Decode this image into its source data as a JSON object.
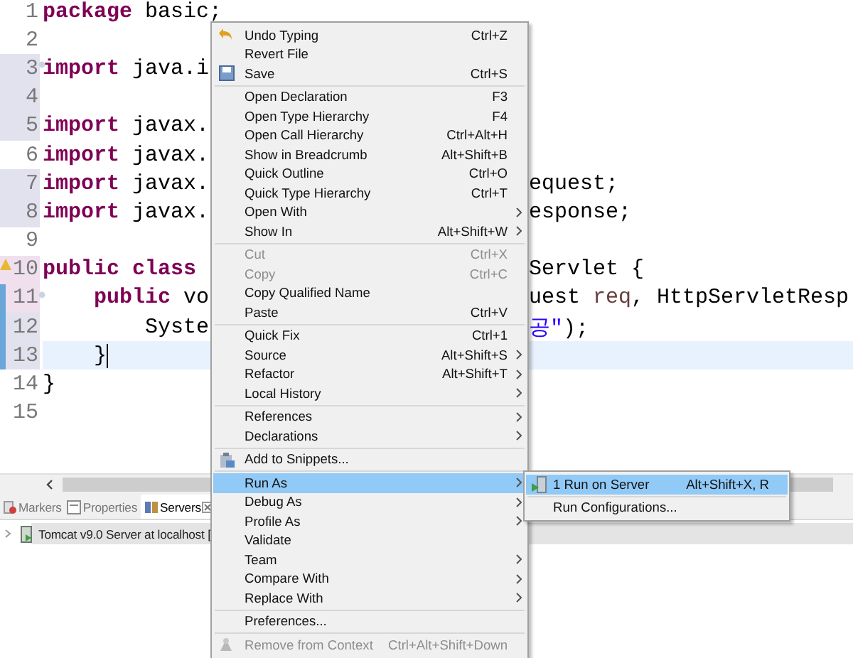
{
  "editor": {
    "lines": [
      {
        "number": "1",
        "changed": false,
        "added": false,
        "current": false,
        "left": [
          {
            "text": "package",
            "kind": "keyword"
          },
          {
            "text": " basic;",
            "kind": "plain"
          }
        ]
      },
      {
        "number": "2",
        "changed": false,
        "added": false,
        "current": false
      },
      {
        "number": "3",
        "changed": true,
        "added": false,
        "fold": true,
        "current": false,
        "left": [
          {
            "text": "import",
            "kind": "keyword"
          },
          {
            "text": " java.i",
            "kind": "plain"
          }
        ]
      },
      {
        "number": "4",
        "changed": true,
        "added": false,
        "current": false
      },
      {
        "number": "5",
        "changed": true,
        "added": false,
        "current": false,
        "left": [
          {
            "text": "import",
            "kind": "keyword"
          },
          {
            "text": " javax.",
            "kind": "plain"
          }
        ]
      },
      {
        "number": "6",
        "changed": false,
        "added": false,
        "current": false,
        "left": [
          {
            "text": "import",
            "kind": "keyword"
          },
          {
            "text": " javax.",
            "kind": "plain"
          }
        ]
      },
      {
        "number": "7",
        "changed": true,
        "added": false,
        "current": false,
        "left": [
          {
            "text": "import",
            "kind": "keyword"
          },
          {
            "text": " javax.",
            "kind": "plain"
          }
        ],
        "right": [
          {
            "text": "equest;",
            "kind": "plain"
          }
        ]
      },
      {
        "number": "8",
        "changed": true,
        "added": false,
        "current": false,
        "left": [
          {
            "text": "import",
            "kind": "keyword"
          },
          {
            "text": " javax.",
            "kind": "plain"
          }
        ],
        "right": [
          {
            "text": "esponse;",
            "kind": "plain"
          }
        ]
      },
      {
        "number": "9",
        "changed": false,
        "added": false,
        "current": false
      },
      {
        "number": "10",
        "changed": false,
        "added": true,
        "warning": true,
        "current": false,
        "left": [
          {
            "text": "public",
            "kind": "keyword"
          },
          {
            "text": " class",
            "kind": "keyword"
          }
        ],
        "right": [
          {
            "text": "Servlet {",
            "kind": "plain"
          }
        ]
      },
      {
        "number": "11",
        "changed": false,
        "added": true,
        "fold": true,
        "bar": true,
        "current": false,
        "left": [
          {
            "text": "    public",
            "kind": "keyword"
          },
          {
            "text": " vo",
            "kind": "plain"
          }
        ],
        "right": [
          {
            "text": "uest ",
            "kind": "plain"
          },
          {
            "text": "req",
            "kind": "param"
          },
          {
            "text": ", HttpServletResp",
            "kind": "plain"
          }
        ]
      },
      {
        "number": "12",
        "changed": true,
        "added": false,
        "bar": true,
        "current": false,
        "left": [
          {
            "text": "        Syste",
            "kind": "plain"
          }
        ],
        "right": [
          {
            "text": "공\"",
            "kind": "string"
          },
          {
            "text": ");",
            "kind": "plain"
          }
        ]
      },
      {
        "number": "13",
        "changed": true,
        "added": false,
        "bar": true,
        "current": true,
        "left": [
          {
            "text": "    }",
            "kind": "plain"
          }
        ]
      },
      {
        "number": "14",
        "changed": false,
        "added": false,
        "current": false,
        "left": [
          {
            "text": "}",
            "kind": "plain"
          }
        ]
      },
      {
        "number": "15",
        "changed": false,
        "added": false,
        "current": false
      }
    ]
  },
  "panel": {
    "tabs": [
      {
        "label": "Markers",
        "selected": false,
        "kind": "markers"
      },
      {
        "label": "Properties",
        "selected": false,
        "kind": "properties"
      },
      {
        "label": "Servers",
        "selected": true,
        "kind": "servers"
      }
    ],
    "rows": [
      {
        "label": "Tomcat v9.0 Server at localhost [",
        "selected": true
      }
    ]
  },
  "context_menu": {
    "groups": [
      [
        {
          "label": "Undo Typing",
          "shortcut": "Ctrl+Z",
          "kind": "undo",
          "disabled": false,
          "submenu": false,
          "selected": false
        },
        {
          "label": "Revert File",
          "disabled": false,
          "submenu": false,
          "selected": false
        },
        {
          "label": "Save",
          "shortcut": "Ctrl+S",
          "kind": "save",
          "disabled": false,
          "submenu": false,
          "selected": false
        }
      ],
      [
        {
          "label": "Open Declaration",
          "shortcut": "F3",
          "disabled": false,
          "submenu": false,
          "selected": false
        },
        {
          "label": "Open Type Hierarchy",
          "shortcut": "F4",
          "disabled": false,
          "submenu": false,
          "selected": false
        },
        {
          "label": "Open Call Hierarchy",
          "shortcut": "Ctrl+Alt+H",
          "disabled": false,
          "submenu": false,
          "selected": false
        },
        {
          "label": "Show in Breadcrumb",
          "shortcut": "Alt+Shift+B",
          "disabled": false,
          "submenu": false,
          "selected": false
        },
        {
          "label": "Quick Outline",
          "shortcut": "Ctrl+O",
          "disabled": false,
          "submenu": false,
          "selected": false
        },
        {
          "label": "Quick Type Hierarchy",
          "shortcut": "Ctrl+T",
          "disabled": false,
          "submenu": false,
          "selected": false
        },
        {
          "label": "Open With",
          "disabled": false,
          "submenu": true,
          "selected": false
        },
        {
          "label": "Show In",
          "shortcut": "Alt+Shift+W",
          "disabled": false,
          "submenu": true,
          "selected": false
        }
      ],
      [
        {
          "label": "Cut",
          "shortcut": "Ctrl+X",
          "disabled": true,
          "submenu": false,
          "selected": false
        },
        {
          "label": "Copy",
          "shortcut": "Ctrl+C",
          "disabled": true,
          "submenu": false,
          "selected": false
        },
        {
          "label": "Copy Qualified Name",
          "disabled": false,
          "submenu": false,
          "selected": false
        },
        {
          "label": "Paste",
          "shortcut": "Ctrl+V",
          "disabled": false,
          "submenu": false,
          "selected": false
        }
      ],
      [
        {
          "label": "Quick Fix",
          "shortcut": "Ctrl+1",
          "disabled": false,
          "submenu": false,
          "selected": false
        },
        {
          "label": "Source",
          "shortcut": "Alt+Shift+S",
          "disabled": false,
          "submenu": true,
          "selected": false
        },
        {
          "label": "Refactor",
          "shortcut": "Alt+Shift+T",
          "disabled": false,
          "submenu": true,
          "selected": false
        },
        {
          "label": "Local History",
          "disabled": false,
          "submenu": true,
          "selected": false
        }
      ],
      [
        {
          "label": "References",
          "disabled": false,
          "submenu": true,
          "selected": false
        },
        {
          "label": "Declarations",
          "disabled": false,
          "submenu": true,
          "selected": false
        }
      ],
      [
        {
          "label": "Add to Snippets...",
          "kind": "snippet",
          "disabled": false,
          "submenu": false,
          "selected": false
        }
      ],
      [
        {
          "label": "Run As",
          "disabled": false,
          "submenu": true,
          "selected": true
        },
        {
          "label": "Debug As",
          "disabled": false,
          "submenu": true,
          "selected": false
        },
        {
          "label": "Profile As",
          "disabled": false,
          "submenu": true,
          "selected": false
        },
        {
          "label": "Validate",
          "disabled": false,
          "submenu": false,
          "selected": false
        },
        {
          "label": "Team",
          "disabled": false,
          "submenu": true,
          "selected": false
        },
        {
          "label": "Compare With",
          "disabled": false,
          "submenu": true,
          "selected": false
        },
        {
          "label": "Replace With",
          "disabled": false,
          "submenu": true,
          "selected": false
        }
      ],
      [
        {
          "label": "Preferences...",
          "disabled": false,
          "submenu": false,
          "selected": false
        }
      ],
      [
        {
          "label": "Remove from Context",
          "shortcut": "Ctrl+Alt+Shift+Down",
          "kind": "context",
          "disabled": true,
          "submenu": false,
          "selected": false
        }
      ]
    ]
  },
  "submenu": {
    "groups": [
      [
        {
          "label": "1 Run on Server",
          "shortcut": "Alt+Shift+X, R",
          "kind": "server",
          "disabled": false,
          "submenu": false,
          "selected": true
        }
      ],
      [
        {
          "label": "Run Configurations...",
          "disabled": false,
          "submenu": false,
          "selected": false
        }
      ]
    ]
  }
}
